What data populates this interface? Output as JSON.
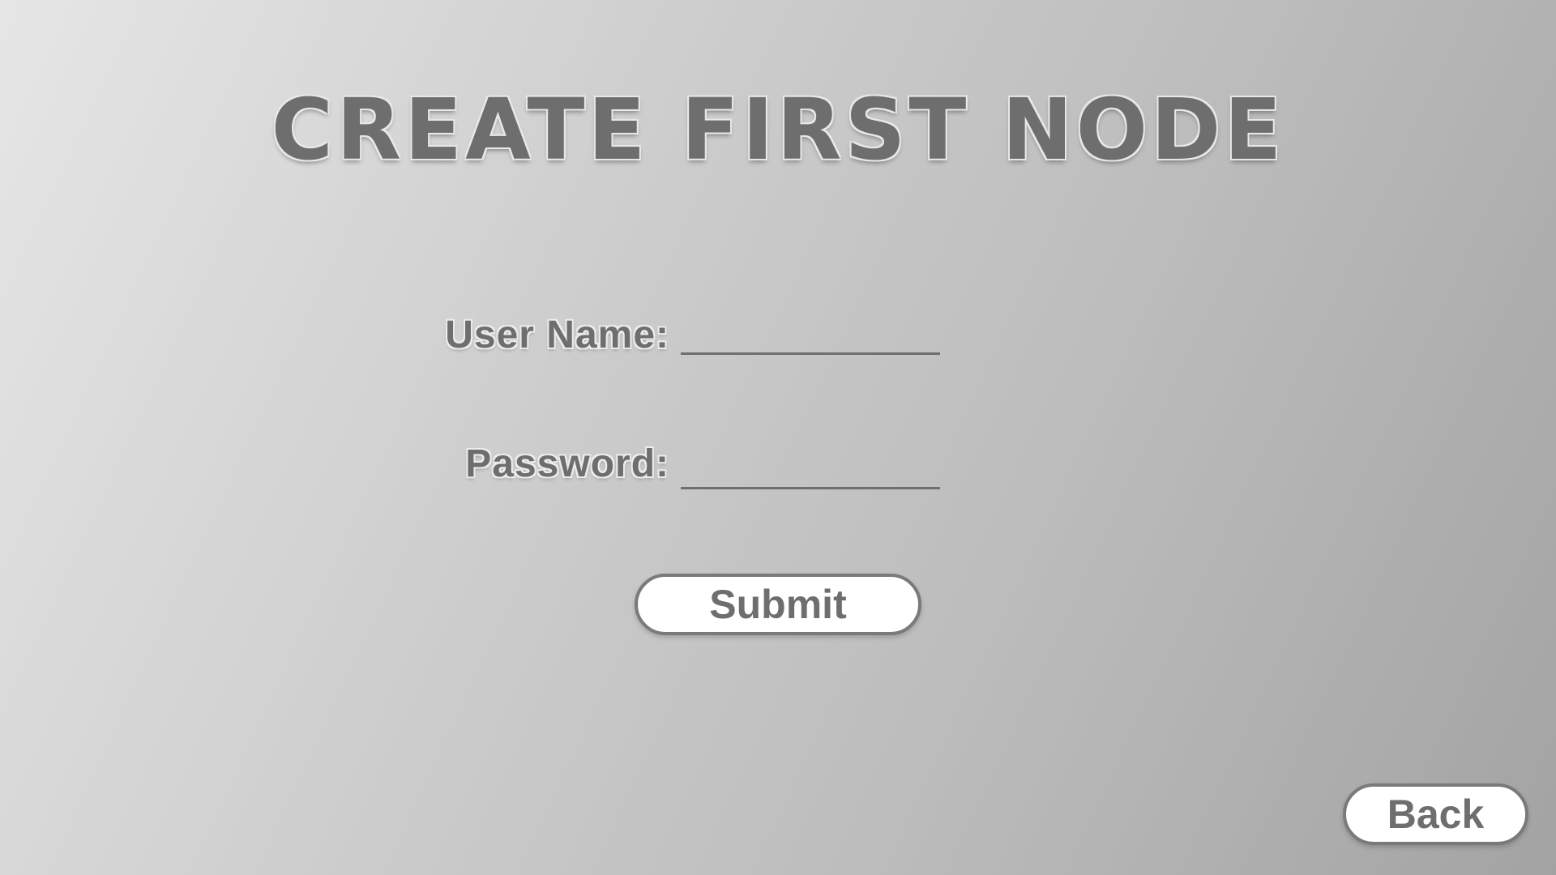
{
  "screen": {
    "title": "CREATE FIRST NODE"
  },
  "form": {
    "username_label": "User Name:",
    "username_value": "",
    "password_label": "Password:",
    "password_value": "",
    "submit_label": "Submit"
  },
  "navigation": {
    "back_label": "Back"
  }
}
